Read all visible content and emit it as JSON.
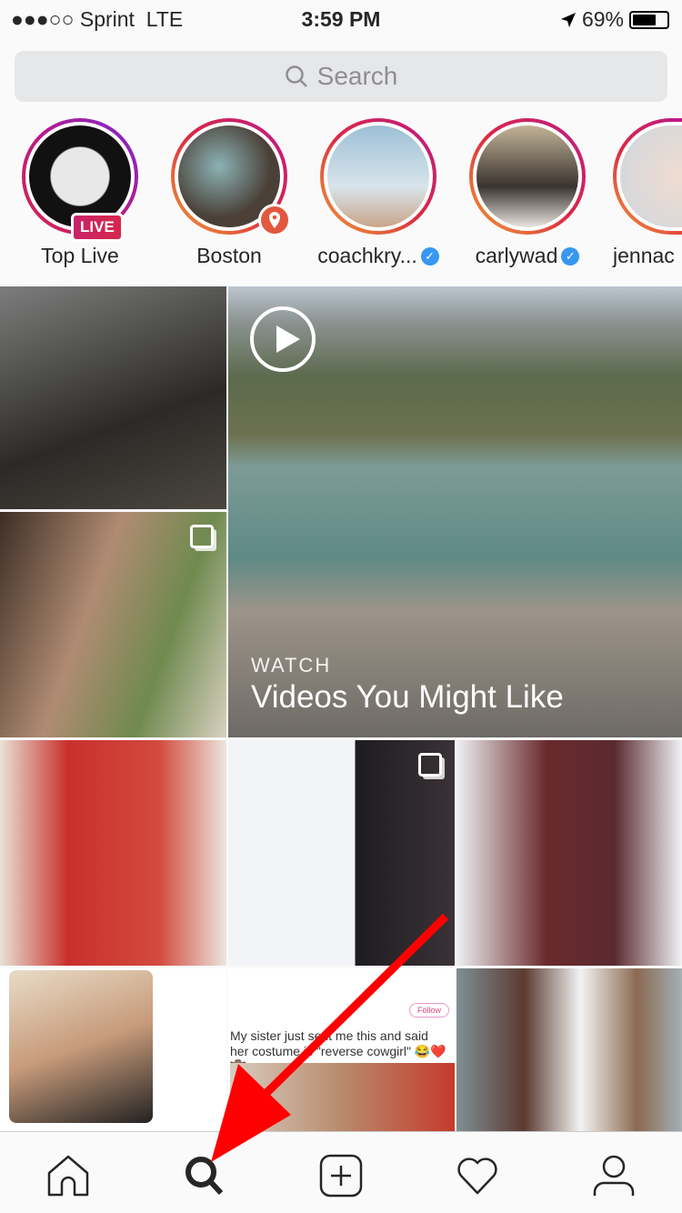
{
  "status_bar": {
    "carrier": "●●●○○ Sprint",
    "network": "LTE",
    "time": "3:59 PM",
    "battery": "69%",
    "battery_level": 0.69
  },
  "search": {
    "placeholder": "Search"
  },
  "stories": [
    {
      "label": "Top Live",
      "badge": "LIVE",
      "color": "#333333"
    },
    {
      "label": "Boston",
      "badge": "location-pin-icon",
      "color": "#5a5045"
    },
    {
      "label": "coachkry...",
      "verified": true,
      "color": "#8fb3c9"
    },
    {
      "label": "carlywad",
      "verified": true,
      "color": "#b8a990"
    },
    {
      "label": "jennac",
      "color": "#e4d6cc"
    }
  ],
  "featured": {
    "kicker": "WATCH",
    "title": "Videos You Might Like"
  },
  "tweet_text": "My sister just sent me this and said her costume is \"reverse cowgirl\" 😂❤️🤠",
  "tweet_follow": "Follow",
  "tabs": [
    "home",
    "search",
    "new-post",
    "activity",
    "profile"
  ],
  "active_tab": "search",
  "annotation_color": "#ff0000"
}
